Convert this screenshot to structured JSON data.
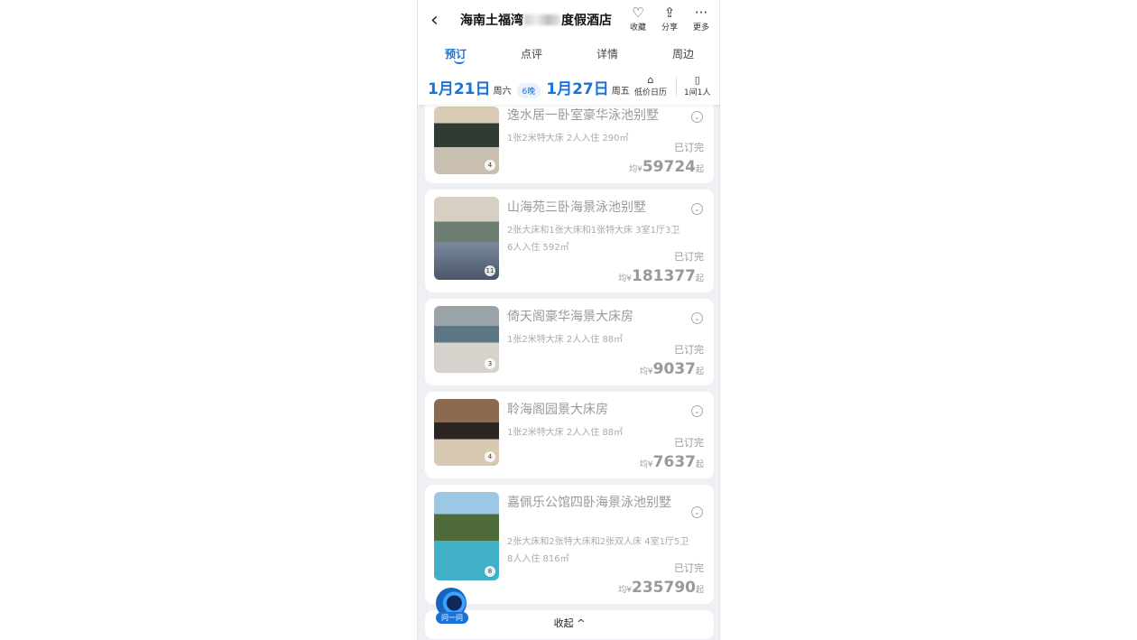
{
  "header": {
    "title_start": "海南土福湾",
    "title_end": "度假酒店",
    "actions": [
      {
        "icon": "heart-icon",
        "label": "收藏"
      },
      {
        "icon": "share-icon",
        "label": "分享"
      },
      {
        "icon": "more-icon",
        "label": "更多"
      }
    ]
  },
  "tabs": [
    {
      "label": "预订",
      "active": true
    },
    {
      "label": "点评"
    },
    {
      "label": "详情"
    },
    {
      "label": "周边"
    }
  ],
  "dates": {
    "checkin": "1月21日",
    "checkin_weekday": "周六",
    "nights": "6晚",
    "checkout": "1月27日",
    "checkout_weekday": "周五",
    "calendar_label": "低价日历",
    "rooms_label": "1间1人"
  },
  "rooms": [
    {
      "name": "逸水居一卧室豪华泳池别墅",
      "details": [
        "1张2米特大床  2人入住  290㎡"
      ],
      "photos": "4",
      "status": "已订完",
      "prefix": "均¥",
      "price": "59724",
      "suffix": "起"
    },
    {
      "name": "山海苑三卧海景泳池别墅",
      "details": [
        "2张大床和1张大床和1张特大床  3室1厅3卫",
        "6人入住  592㎡"
      ],
      "photos": "11",
      "status": "已订完",
      "prefix": "均¥",
      "price": "181377",
      "suffix": "起"
    },
    {
      "name": "倚天阁豪华海景大床房",
      "details": [
        "1张2米特大床  2人入住  88㎡"
      ],
      "photos": "3",
      "status": "已订完",
      "prefix": "均¥",
      "price": "9037",
      "suffix": "起"
    },
    {
      "name": "聆海阁园景大床房",
      "details": [
        "1张2米特大床  2人入住  88㎡"
      ],
      "photos": "4",
      "status": "已订完",
      "prefix": "均¥",
      "price": "7637",
      "suffix": "起"
    },
    {
      "name": "嘉佩乐公馆四卧海景泳池别墅",
      "details": [
        "2张大床和2张特大床和2张双人床  4室1厅5卫",
        "8人入住  816㎡"
      ],
      "photos": "8",
      "status": "已订完",
      "prefix": "均¥",
      "price": "235790",
      "suffix": "起"
    }
  ],
  "footer": {
    "collapse_label": "收起 ^"
  },
  "assistant": {
    "label": "问一问"
  },
  "colors": {
    "accent": "#1a73d9",
    "background": "#eef0f4"
  }
}
